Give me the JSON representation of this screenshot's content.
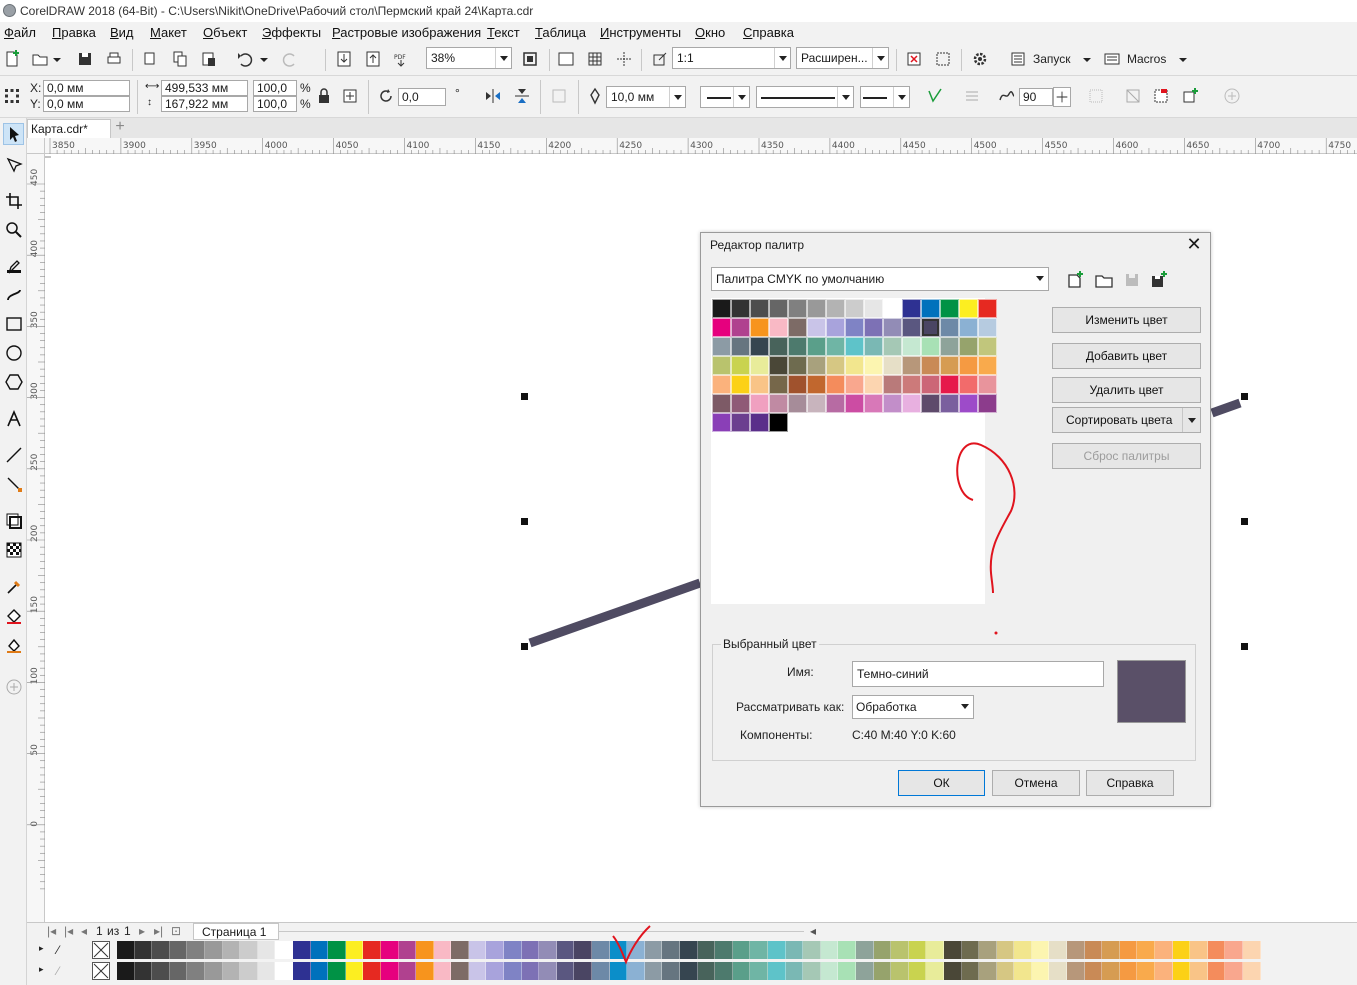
{
  "window": {
    "title": "CorelDRAW 2018 (64-Bit) - C:\\Users\\Nikit\\OneDrive\\Рабочий стол\\Пермский край 24\\Карта.cdr"
  },
  "menu": [
    "Файл",
    "Правка",
    "Вид",
    "Макет",
    "Объект",
    "Эффекты",
    "Растровые изображения",
    "Текст",
    "Таблица",
    "Инструменты",
    "Окно",
    "Справка"
  ],
  "toolbar1": {
    "zoom": "38%",
    "scale": "1:1",
    "snap": "Расширен...",
    "launch": "Запуск",
    "macros": "Macros"
  },
  "toolbar2": {
    "x": "0,0 мм",
    "y": "0,0 мм",
    "width": "499,533 мм",
    "height": "167,922 мм",
    "scale_x": "100,0",
    "scale_y": "100,0",
    "percent": "%",
    "x_label": "X:",
    "y_label": "Y:",
    "rotation": "0,0",
    "degree": "°",
    "outline_width": "10,0 мм",
    "angle": "90"
  },
  "document": {
    "tab": "Карта.cdr*",
    "add_tab": "+"
  },
  "ruler": {
    "h_ticks": [
      "3850",
      "3900",
      "3950",
      "4000",
      "4050",
      "4100",
      "4150",
      "4200",
      "4250",
      "4300",
      "4350",
      "4400",
      "4450",
      "4500",
      "4550",
      "4600",
      "4650",
      "4700",
      "4750"
    ],
    "v_ticks": [
      "450",
      "400",
      "350",
      "300",
      "250",
      "200",
      "150",
      "100",
      "50",
      "0"
    ]
  },
  "pagebar": {
    "page_num": "1",
    "of": "из",
    "total": "1",
    "page_tab": "Страница 1"
  },
  "dialog": {
    "title": "Редактор палитр",
    "palette_name": "Палитра CMYK по умолчанию",
    "buttons": {
      "edit": "Изменить цвет",
      "add": "Добавить цвет",
      "delete": "Удалить цвет",
      "sort": "Сортировать цвета",
      "reset": "Сброс палитры"
    },
    "selected_group": "Выбранный цвет",
    "name_label": "Имя:",
    "name_value": "Темно-синий",
    "treat_as_label": "Рассматривать как:",
    "treat_as_value": "Обработка",
    "components_label": "Компоненты:",
    "components_value": "C:40 M:40 Y:0 K:60",
    "selected_color": "#5a5068",
    "ok": "ОК",
    "cancel": "Отмена",
    "help": "Справка"
  },
  "palette_colors": [
    "#1a1a1a",
    "#333333",
    "#4d4d4d",
    "#666666",
    "#808080",
    "#999999",
    "#b3b3b3",
    "#cccccc",
    "#e6e6e6",
    "#ffffff",
    "#2e3192",
    "#0071bc",
    "#009245",
    "#fcee21",
    "#e62921",
    "#e6007e",
    "#b0418f",
    "#f7941d",
    "#f9b9c5",
    "#7d6b66",
    "#c9c4e8",
    "#a8a3dc",
    "#7f83c5",
    "#7d71b5",
    "#928cb6",
    "#5a5780",
    "#4a4563",
    "#6d89a7",
    "#8bb1d3",
    "#b6cbe0",
    "#8c9ba5",
    "#667580",
    "#364550",
    "#48635b",
    "#4d7a6d",
    "#5a9f8a",
    "#6fb5a5",
    "#5ec3c9",
    "#7ab8b4",
    "#a5c8b5",
    "#c5e8d1",
    "#a8e1b5",
    "#8ea39a",
    "#96a36c",
    "#c1c67c",
    "#b9c36d",
    "#c9d34f",
    "#e8ec9a",
    "#4a4737",
    "#6e6b4f",
    "#a8a17d",
    "#d6c783",
    "#f2e68e",
    "#fcf5b0",
    "#e6dfc7",
    "#b7977a",
    "#c98a56",
    "#d69c52",
    "#f59a42",
    "#f9aa4c",
    "#fbb27c",
    "#fcd116",
    "#f9c487",
    "#76674a",
    "#a0522d",
    "#c1672e",
    "#f48c5c",
    "#f9a78e",
    "#fcd5b0",
    "#b97a7a",
    "#cc7a7a",
    "#cc6677",
    "#e6194b",
    "#f26b6b",
    "#e8949c",
    "#7d5a66",
    "#8f5a77",
    "#f0a0c0",
    "#c08aa3",
    "#a68c99",
    "#c8b4bd",
    "#b76ba3",
    "#cc4ca3",
    "#d878b8",
    "#c28ec9",
    "#e8b0e0",
    "#5e4a6b",
    "#7a5f9e",
    "#9d4bc9",
    "#8c3c8c",
    "#8a3fb7",
    "#6b3f8f",
    "#5a2f8a",
    "#000000"
  ],
  "docker_palette": [
    "#1a1a1a",
    "#333333",
    "#4d4d4d",
    "#666666",
    "#808080",
    "#999999",
    "#b3b3b3",
    "#cccccc",
    "#e6e6e6",
    "#ffffff",
    "#2e3192",
    "#0071bc",
    "#009245",
    "#fcee21",
    "#e62921",
    "#e6007e",
    "#b0418f",
    "#f7941d",
    "#f9b9c5",
    "#7d6b66",
    "#c9c4e8",
    "#a8a3dc",
    "#7f83c5",
    "#7d71b5",
    "#928cb6",
    "#5a5780",
    "#4a4563",
    "#6d89a7",
    "#0b8ec9",
    "#8bb1d3",
    "#8c9ba5",
    "#667580",
    "#364550",
    "#48635b",
    "#4d7a6d",
    "#5a9f8a",
    "#6fb5a5",
    "#5ec3c9",
    "#7ab8b4",
    "#a5c8b5",
    "#c5e8d1",
    "#a8e1b5",
    "#8ea39a",
    "#96a36c",
    "#b9c36d",
    "#c9d34f",
    "#e8ec9a",
    "#4a4737",
    "#6e6b4f",
    "#a8a17d",
    "#d6c783",
    "#f2e68e",
    "#fcf5b0",
    "#e6dfc7",
    "#b7977a",
    "#c98a56",
    "#d69c52",
    "#f59a42",
    "#f9aa4c",
    "#fbb27c",
    "#fcd116",
    "#f9c487",
    "#f48c5c",
    "#f9a78e",
    "#fcd5b0"
  ],
  "colors": {
    "shape_stroke": "#4f4b62",
    "annotation": "#e0141e",
    "accent": "#0078d7"
  }
}
